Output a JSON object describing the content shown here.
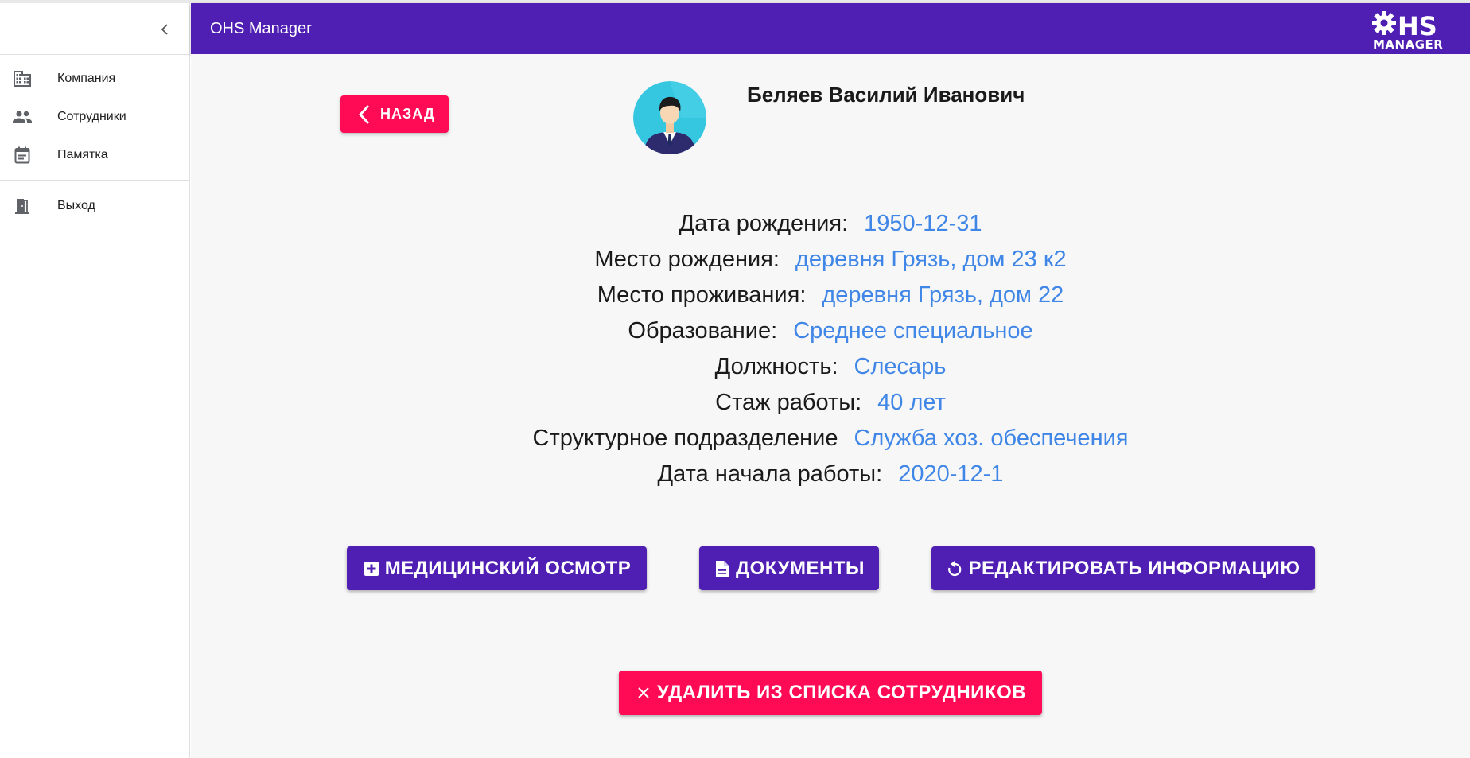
{
  "app": {
    "title": "OHS Manager",
    "logo_text_top": "HS",
    "logo_text_bottom": "MANAGER"
  },
  "sidebar": {
    "items": [
      {
        "label": "Компания",
        "icon": "building-icon"
      },
      {
        "label": "Сотрудники",
        "icon": "people-icon"
      },
      {
        "label": "Памятка",
        "icon": "calendar-note-icon"
      },
      {
        "label": "Выход",
        "icon": "exit-door-icon"
      }
    ]
  },
  "back_button": {
    "label": "НАЗАД"
  },
  "employee": {
    "name": "Беляев Василий Иванович",
    "fields": [
      {
        "label": "Дата рождения:",
        "value": "1950-12-31"
      },
      {
        "label": "Место рождения:",
        "value": "деревня Грязь, дом 23 к2"
      },
      {
        "label": "Место проживания:",
        "value": "деревня Грязь, дом 22"
      },
      {
        "label": "Образование:",
        "value": "Среднее специальное"
      },
      {
        "label": "Должность:",
        "value": "Слесарь"
      },
      {
        "label": "Стаж работы:",
        "value": "40 лет"
      },
      {
        "label": "Структурное подразделение",
        "value": "Служба хоз. обеспечения"
      },
      {
        "label": "Дата начала работы:",
        "value": "2020-12-1"
      }
    ]
  },
  "actions": {
    "medical_label": "МЕДИЦИНСКИЙ ОСМОТР",
    "documents_label": "ДОКУМЕНТЫ",
    "edit_label": "РЕДАКТИРОВАТЬ ИНФОРМАЦИЮ",
    "delete_label": "УДАЛИТЬ ИЗ СПИСКА СОТРУДНИКОВ"
  },
  "colors": {
    "primary": "#4f1fb3",
    "accent": "#ff0a54",
    "value_text": "#3f86e6"
  }
}
